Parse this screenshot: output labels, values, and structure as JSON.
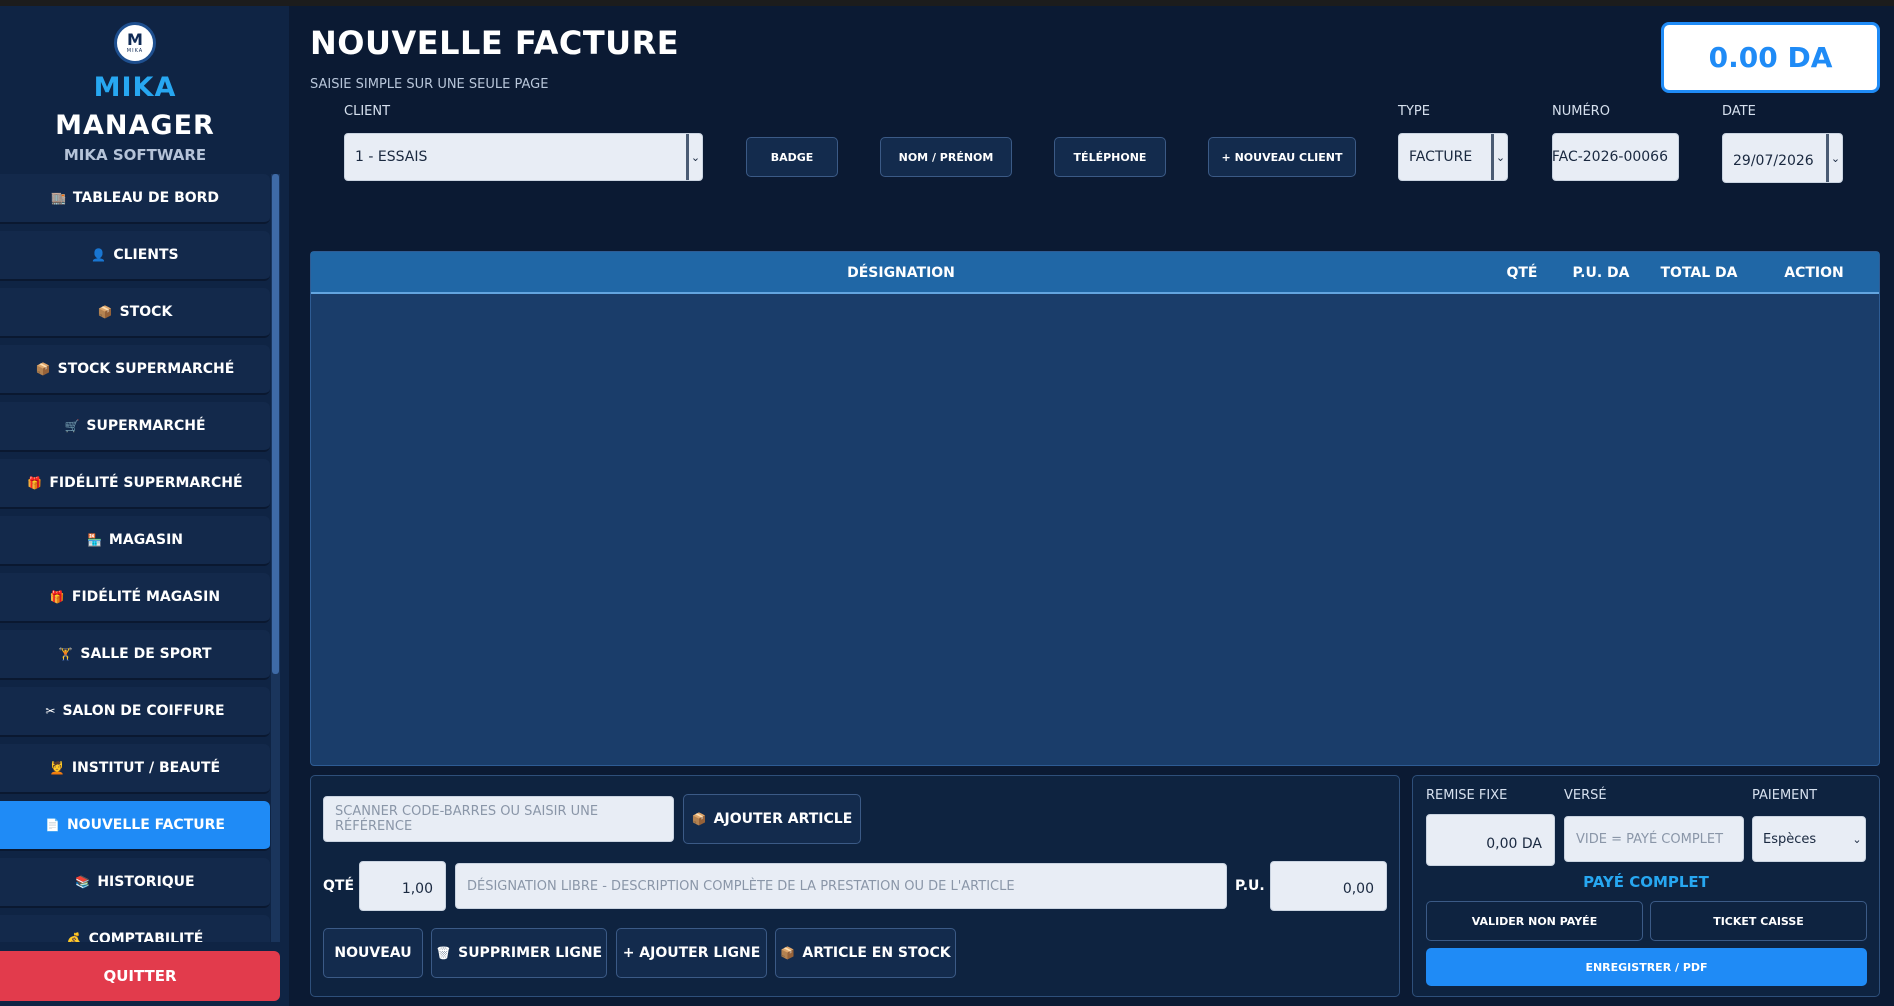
{
  "brand": {
    "logo_text": "M",
    "logo_subtext": "MIKA",
    "name_line1": "MIKA",
    "name_line2": "MANAGER",
    "tagline": "MIKA SOFTWARE"
  },
  "sidebar": {
    "items": [
      {
        "icon": "🏬",
        "label": "TABLEAU DE BORD"
      },
      {
        "icon": "👤",
        "label": "CLIENTS"
      },
      {
        "icon": "📦",
        "label": "STOCK"
      },
      {
        "icon": "📦",
        "label": "STOCK SUPERMARCHÉ"
      },
      {
        "icon": "🛒",
        "label": "SUPERMARCHÉ"
      },
      {
        "icon": "🎁",
        "label": "FIDÉLITÉ SUPERMARCHÉ"
      },
      {
        "icon": "🏪",
        "label": "MAGASIN"
      },
      {
        "icon": "🎁",
        "label": "FIDÉLITÉ MAGASIN"
      },
      {
        "icon": "🏋",
        "label": "SALLE DE SPORT"
      },
      {
        "icon": "✂",
        "label": "SALON DE COIFFURE"
      },
      {
        "icon": "💆",
        "label": "INSTITUT / BEAUTÉ"
      },
      {
        "icon": "📄",
        "label": "NOUVELLE FACTURE"
      },
      {
        "icon": "📚",
        "label": "HISTORIQUE"
      },
      {
        "icon": "💰",
        "label": "COMPTABILITÉ"
      }
    ],
    "quit_label": "QUITTER"
  },
  "header": {
    "title": "NOUVELLE FACTURE",
    "subtitle": "SAISIE SIMPLE SUR UNE SEULE PAGE",
    "total": "0.00 DA"
  },
  "form": {
    "client_label": "CLIENT",
    "client_value": "1 - ESSAIS",
    "badge_button": "BADGE",
    "name_button": "NOM / PRÉNOM",
    "phone_button": "TÉLÉPHONE",
    "new_client_button": "+ NOUVEAU CLIENT",
    "type_label": "TYPE",
    "type_value": "FACTURE",
    "number_label": "NUMÉRO",
    "number_value": "FAC-2026-00066",
    "date_label": "DATE",
    "date_value": "29/07/2026"
  },
  "table": {
    "columns": [
      "DÉSIGNATION",
      "QTÉ",
      "P.U. DA",
      "TOTAL DA",
      "ACTION"
    ],
    "rows": []
  },
  "entry": {
    "barcode_placeholder": "SCANNER CODE-BARRES OU SAISIR UNE RÉFÉRENCE",
    "add_article_button": "AJOUTER ARTICLE",
    "add_article_icon": "📦",
    "qty_label": "QTÉ",
    "qty_value": "1,00",
    "designation_placeholder": "DÉSIGNATION LIBRE - DESCRIPTION COMPLÈTE DE LA PRESTATION OU DE L'ARTICLE",
    "pu_label": "P.U.",
    "pu_value": "0,00",
    "new_button": "NOUVEAU",
    "delete_line_button": "SUPPRIMER LIGNE",
    "delete_icon": "🗑",
    "add_line_button": "+ AJOUTER LIGNE",
    "stock_article_button": "ARTICLE EN STOCK",
    "stock_icon": "📦"
  },
  "payment": {
    "discount_label": "REMISE FIXE",
    "discount_value": "0,00 DA",
    "paid_label": "VERSÉ",
    "paid_placeholder": "VIDE = PAYÉ COMPLET",
    "method_label": "PAIEMENT",
    "method_value": "Espèces",
    "status": "PAYÉ COMPLET",
    "unpaid_button": "VALIDER NON PAYÉE",
    "ticket_button": "TICKET CAISSE",
    "save_button": "ENREGISTRER / PDF"
  },
  "colors": {
    "background": "#0b1a33",
    "sidebar": "#0f2444",
    "accent": "#1f8bf6",
    "brand_blue": "#27a7f1",
    "danger": "#e23b4c",
    "table_header": "#2067a6"
  }
}
